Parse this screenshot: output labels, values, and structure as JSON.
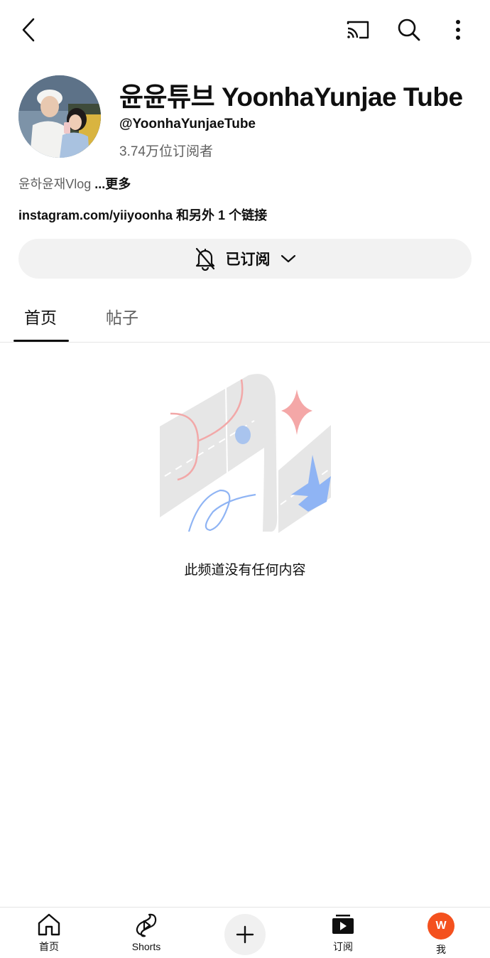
{
  "channel": {
    "title": "윤윤튜브 YoonhaYunjae Tube",
    "handle": "@YoonhaYunjaeTube",
    "subscribers": "3.74万位订阅者",
    "description": "윤하윤재Vlog",
    "more_label": "...更多",
    "links": "instagram.com/yiiyoonha 和另外 1 个链接"
  },
  "subscribe_button": {
    "label": "已订阅",
    "icon": "bell-off-icon"
  },
  "tabs": [
    {
      "label": "首页",
      "active": true
    },
    {
      "label": "帖子",
      "active": false
    }
  ],
  "empty_state": {
    "message": "此频道没有任何内容"
  },
  "bottom_nav": [
    {
      "label": "首页",
      "icon": "home-icon"
    },
    {
      "label": "Shorts",
      "icon": "shorts-icon"
    },
    {
      "label": "",
      "icon": "plus-icon"
    },
    {
      "label": "订阅",
      "icon": "subscriptions-icon"
    },
    {
      "label": "我",
      "icon": "avatar"
    }
  ],
  "me_avatar_letter": "W",
  "colors": {
    "accent": "#f4511e",
    "button_bg": "#f2f2f2",
    "muted_text": "#606060"
  }
}
